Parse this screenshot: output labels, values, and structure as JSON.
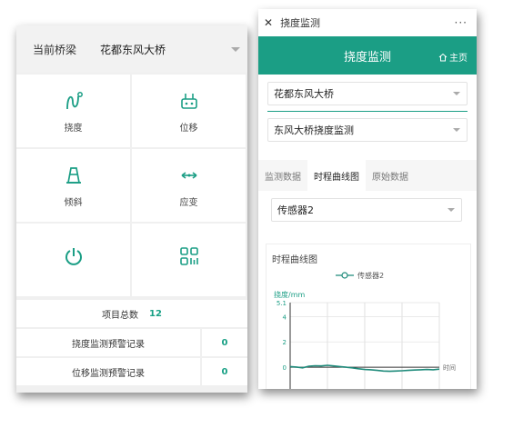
{
  "left": {
    "bridge_label": "当前桥梁",
    "bridge_value": "花都东风大桥",
    "tiles": [
      {
        "label": "挠度",
        "icon": "deflection-icon"
      },
      {
        "label": "位移",
        "icon": "displacement-icon"
      },
      {
        "label": "倾斜",
        "icon": "tilt-icon"
      },
      {
        "label": "应变",
        "icon": "strain-icon"
      },
      {
        "label": "",
        "icon": "power-icon"
      },
      {
        "label": "",
        "icon": "qr-grid-icon"
      }
    ],
    "total_label": "项目总数",
    "total_count": "12",
    "records": [
      {
        "label": "挠度监测预警记录",
        "count": "0"
      },
      {
        "label": "位移监测预警记录",
        "count": "0"
      }
    ]
  },
  "right": {
    "window_title": "挠度监测",
    "more": "···",
    "header_title": "挠度监测",
    "home_label": "主页",
    "select_bridge": "花都东风大桥",
    "select_point": "东风大桥挠度监测",
    "tabs": [
      "监测数据",
      "时程曲线图",
      "原始数据"
    ],
    "active_tab": 1,
    "sensor_select": "传感器2",
    "chart_title": "时程曲线图"
  },
  "colors": {
    "accent": "#1b9e85",
    "count": "#18a085",
    "line": "#1d8a7a"
  },
  "chart_data": {
    "type": "line",
    "title": "",
    "ylabel": "挠度/mm",
    "xlabel": "时间",
    "ylim": [
      -2.5,
      5.1
    ],
    "y_ticks": [
      "5.1",
      "4",
      "2",
      "0",
      "-2"
    ],
    "legend": "传感器2",
    "legend_position": "top-center",
    "grid": true,
    "series": [
      {
        "name": "传感器2",
        "values": [
          0.05,
          0.02,
          -0.05,
          0.08,
          0.12,
          0.1,
          0.15,
          0.1,
          0.05,
          0.0,
          -0.05,
          -0.12,
          -0.18,
          -0.2,
          -0.25,
          -0.3,
          -0.32,
          -0.3,
          -0.28,
          -0.25,
          -0.22,
          -0.2,
          -0.18,
          -0.2,
          -0.15
        ]
      }
    ]
  }
}
